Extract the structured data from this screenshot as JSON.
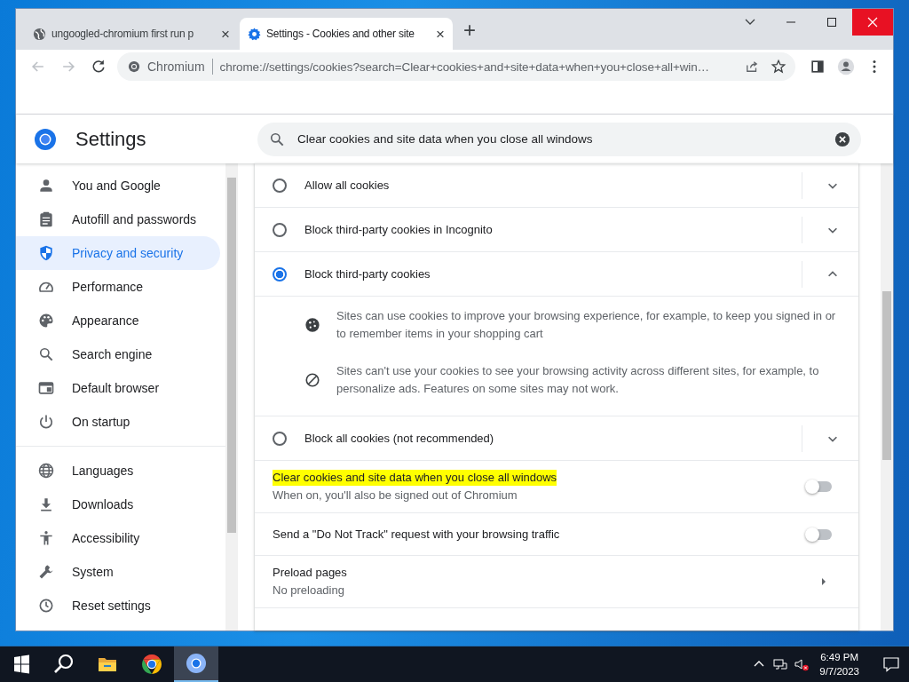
{
  "browser": {
    "tabs": [
      {
        "title": "ungoogled-chromium first run p",
        "selected": false,
        "close": "×"
      },
      {
        "title": "Settings - Cookies and other site",
        "selected": true,
        "close": "×"
      }
    ],
    "new_tab": "+",
    "omnibox": {
      "origin": "Chromium",
      "url": "chrome://settings/cookies?search=Clear+cookies+and+site+data+when+you+close+all+win…"
    }
  },
  "settings": {
    "title": "Settings",
    "search": {
      "value": "Clear cookies and site data when you close all windows"
    },
    "sidebar": [
      {
        "label": "You and Google",
        "selected": false
      },
      {
        "label": "Autofill and passwords",
        "selected": false
      },
      {
        "label": "Privacy and security",
        "selected": true
      },
      {
        "label": "Performance",
        "selected": false
      },
      {
        "label": "Appearance",
        "selected": false
      },
      {
        "label": "Search engine",
        "selected": false
      },
      {
        "label": "Default browser",
        "selected": false
      },
      {
        "label": "On startup",
        "selected": false
      },
      {
        "label": "Languages",
        "selected": false
      },
      {
        "label": "Downloads",
        "selected": false
      },
      {
        "label": "Accessibility",
        "selected": false
      },
      {
        "label": "System",
        "selected": false
      },
      {
        "label": "Reset settings",
        "selected": false
      }
    ],
    "cookie_options": [
      {
        "label": "Allow all cookies",
        "selected": false,
        "expanded": false
      },
      {
        "label": "Block third-party cookies in Incognito",
        "selected": false,
        "expanded": false
      },
      {
        "label": "Block third-party cookies",
        "selected": true,
        "expanded": true,
        "details": [
          "Sites can use cookies to improve your browsing experience, for example, to keep you signed in or to remember items in your shopping cart",
          "Sites can't use your cookies to see your browsing activity across different sites, for example, to personalize ads. Features on some sites may not work."
        ]
      },
      {
        "label": "Block all cookies (not recommended)",
        "selected": false,
        "expanded": false
      }
    ],
    "rows": [
      {
        "kind": "toggle",
        "title": "Clear cookies and site data when you close all windows",
        "highlighted": true,
        "subtitle": "When on, you'll also be signed out of Chromium",
        "on": false
      },
      {
        "kind": "toggle",
        "title": "Send a \"Do Not Track\" request with your browsing traffic",
        "highlighted": false,
        "on": false
      },
      {
        "kind": "link",
        "title": "Preload pages",
        "highlighted": false,
        "subtitle": "No preloading"
      }
    ]
  },
  "taskbar": {
    "apps": [
      {
        "active": false
      },
      {
        "active": false
      },
      {
        "active": true
      }
    ],
    "time": "6:49 PM",
    "date": "9/7/2023"
  }
}
